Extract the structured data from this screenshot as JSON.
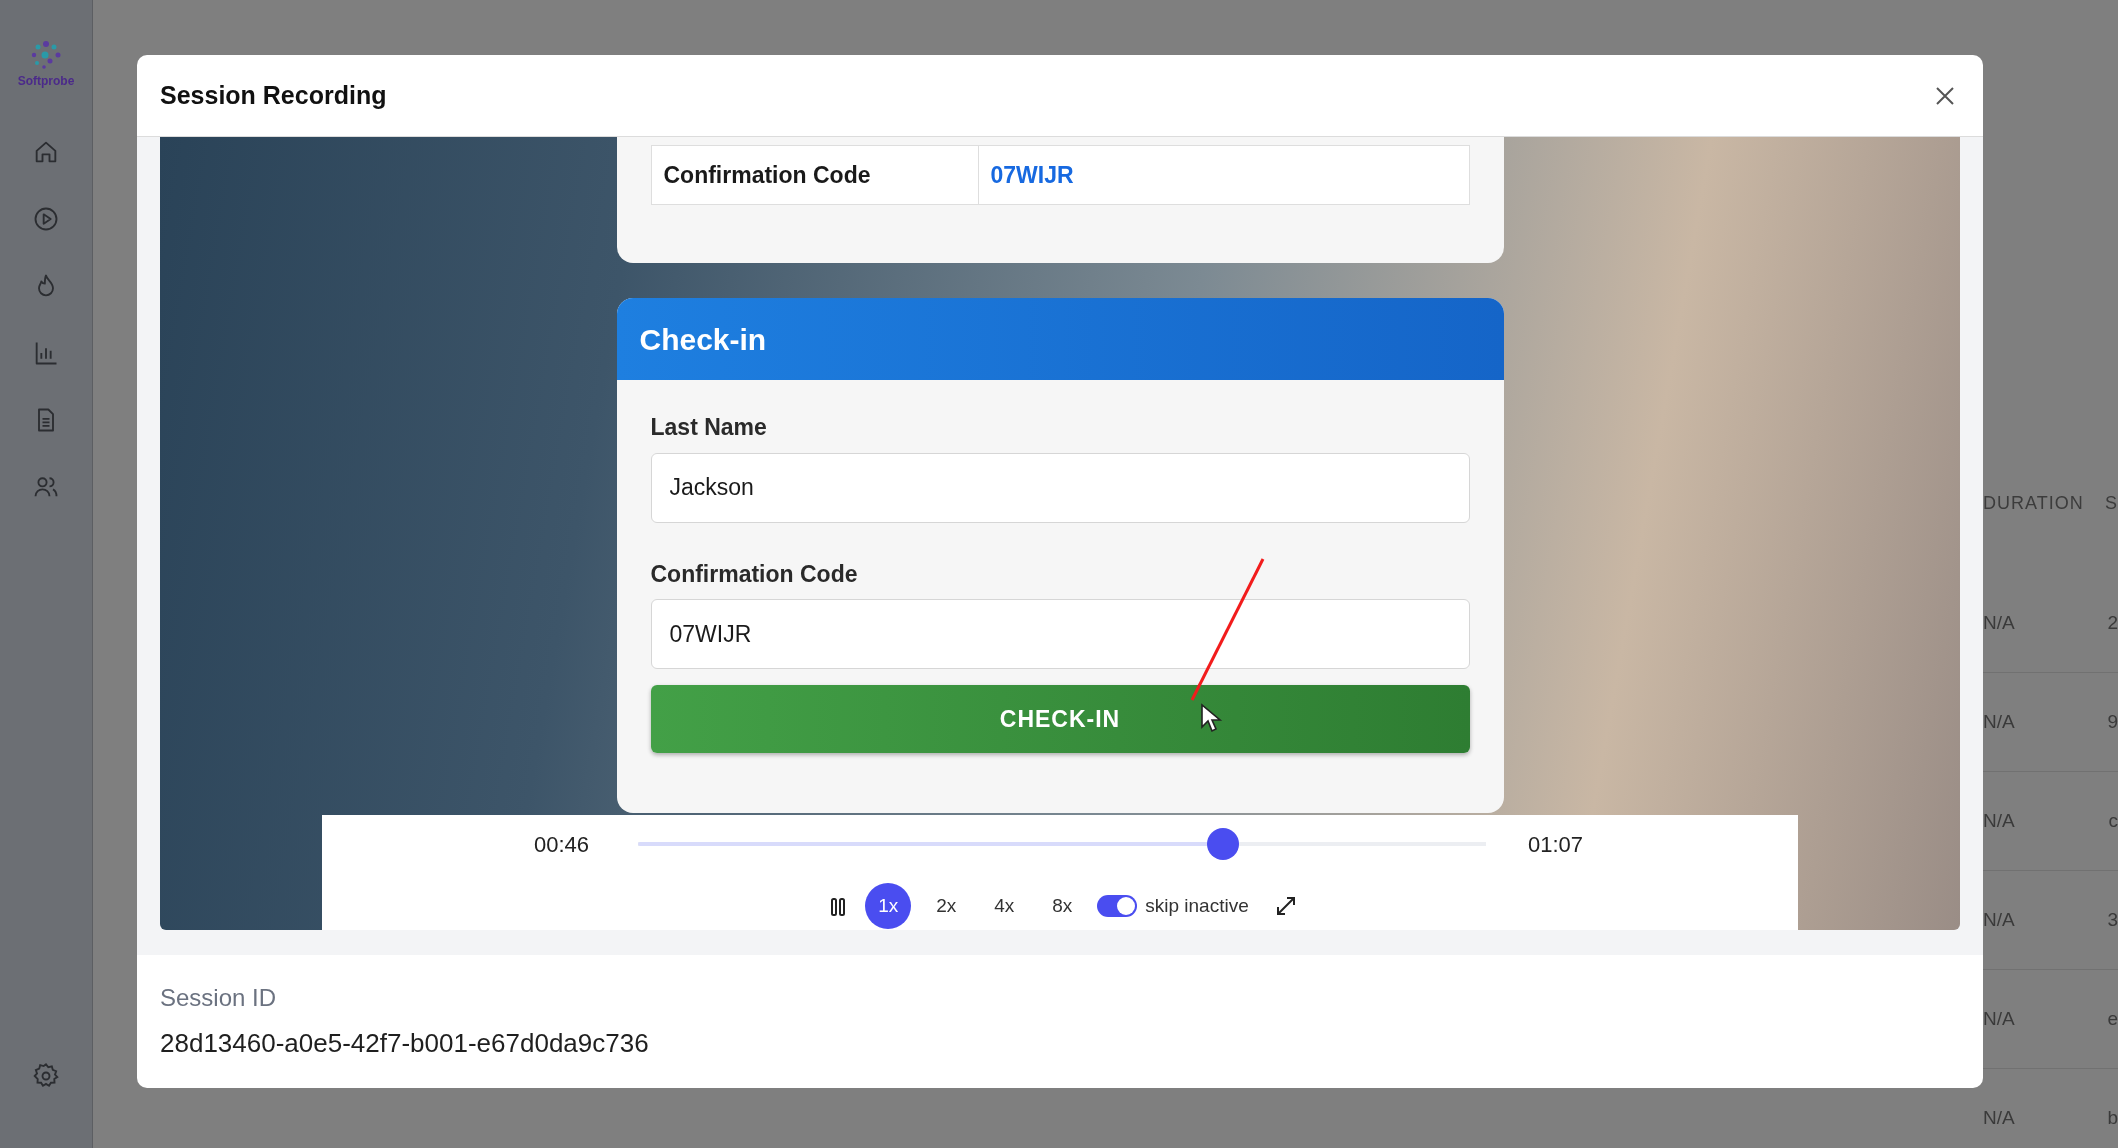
{
  "sidebar": {
    "logo_text": "Softprobe"
  },
  "background_table": {
    "columns": [
      "DURATION",
      "S"
    ],
    "rows": [
      [
        "N/A",
        "2"
      ],
      [
        "N/A",
        "9"
      ],
      [
        "N/A",
        "c"
      ],
      [
        "N/A",
        "3"
      ],
      [
        "N/A",
        "e"
      ],
      [
        "N/A",
        "b"
      ]
    ]
  },
  "modal": {
    "title": "Session Recording",
    "replay": {
      "summary_row": {
        "label": "Confirmation Code",
        "value": "07WIJR"
      },
      "checkin": {
        "title": "Check-in",
        "fields": [
          {
            "label": "Last Name",
            "value": "Jackson"
          },
          {
            "label": "Confirmation Code",
            "value": "07WIJR"
          }
        ],
        "button": "CHECK-IN"
      }
    },
    "player": {
      "current_time": "00:46",
      "total_time": "01:07",
      "level": 0.69,
      "speeds": [
        {
          "label": "1x",
          "selected": true
        },
        {
          "label": "2x",
          "selected": false
        },
        {
          "label": "4x",
          "selected": false
        },
        {
          "label": "8x",
          "selected": false
        }
      ],
      "skip_inactive": {
        "label": "skip inactive",
        "on": true
      }
    },
    "session_id": {
      "label": "Session ID",
      "value": "28d13460-a0e5-42f7-b001-e67d0da9c736"
    }
  }
}
